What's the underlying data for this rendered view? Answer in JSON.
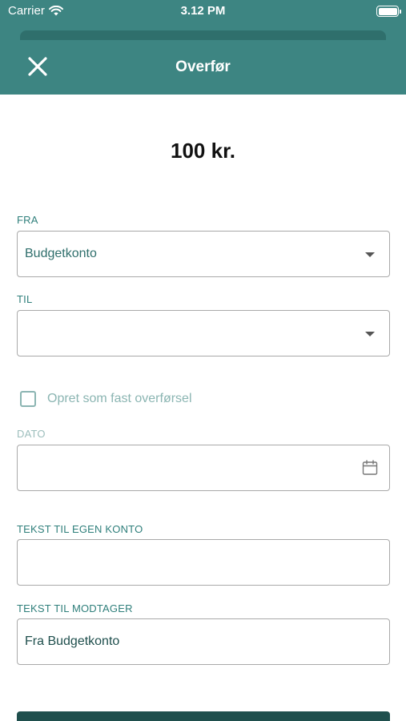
{
  "status_bar": {
    "carrier": "Carrier",
    "time": "3.12 PM"
  },
  "header": {
    "title": "Overfør",
    "close_icon": "close-icon"
  },
  "amount": "100 kr.",
  "form": {
    "from": {
      "label": "FRA",
      "value": "Budgetkonto"
    },
    "to": {
      "label": "TIL",
      "value": ""
    },
    "recurring": {
      "label": "Opret som fast overførsel",
      "checked": false
    },
    "date": {
      "label": "DATO",
      "value": ""
    },
    "own_text": {
      "label": "TEKST TIL EGEN KONTO",
      "value": ""
    },
    "recipient_text": {
      "label": "TEKST TIL MODTAGER",
      "value": "Fra Budgetkonto"
    }
  },
  "colors": {
    "header": "#3d8582",
    "accent": "#2f7f7b",
    "button": "#1f4f4d"
  }
}
